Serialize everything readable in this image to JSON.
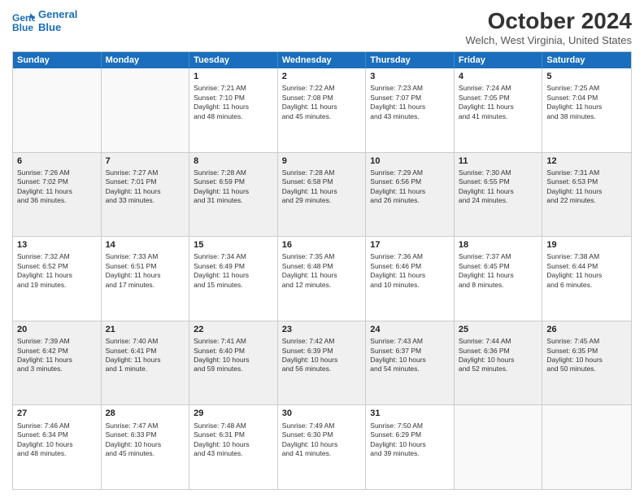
{
  "logo": {
    "line1": "General",
    "line2": "Blue"
  },
  "title": "October 2024",
  "location": "Welch, West Virginia, United States",
  "days": [
    "Sunday",
    "Monday",
    "Tuesday",
    "Wednesday",
    "Thursday",
    "Friday",
    "Saturday"
  ],
  "rows": [
    [
      {
        "day": "",
        "detail": ""
      },
      {
        "day": "",
        "detail": ""
      },
      {
        "day": "1",
        "detail": "Sunrise: 7:21 AM\nSunset: 7:10 PM\nDaylight: 11 hours\nand 48 minutes."
      },
      {
        "day": "2",
        "detail": "Sunrise: 7:22 AM\nSunset: 7:08 PM\nDaylight: 11 hours\nand 45 minutes."
      },
      {
        "day": "3",
        "detail": "Sunrise: 7:23 AM\nSunset: 7:07 PM\nDaylight: 11 hours\nand 43 minutes."
      },
      {
        "day": "4",
        "detail": "Sunrise: 7:24 AM\nSunset: 7:05 PM\nDaylight: 11 hours\nand 41 minutes."
      },
      {
        "day": "5",
        "detail": "Sunrise: 7:25 AM\nSunset: 7:04 PM\nDaylight: 11 hours\nand 38 minutes."
      }
    ],
    [
      {
        "day": "6",
        "detail": "Sunrise: 7:26 AM\nSunset: 7:02 PM\nDaylight: 11 hours\nand 36 minutes."
      },
      {
        "day": "7",
        "detail": "Sunrise: 7:27 AM\nSunset: 7:01 PM\nDaylight: 11 hours\nand 33 minutes."
      },
      {
        "day": "8",
        "detail": "Sunrise: 7:28 AM\nSunset: 6:59 PM\nDaylight: 11 hours\nand 31 minutes."
      },
      {
        "day": "9",
        "detail": "Sunrise: 7:28 AM\nSunset: 6:58 PM\nDaylight: 11 hours\nand 29 minutes."
      },
      {
        "day": "10",
        "detail": "Sunrise: 7:29 AM\nSunset: 6:56 PM\nDaylight: 11 hours\nand 26 minutes."
      },
      {
        "day": "11",
        "detail": "Sunrise: 7:30 AM\nSunset: 6:55 PM\nDaylight: 11 hours\nand 24 minutes."
      },
      {
        "day": "12",
        "detail": "Sunrise: 7:31 AM\nSunset: 6:53 PM\nDaylight: 11 hours\nand 22 minutes."
      }
    ],
    [
      {
        "day": "13",
        "detail": "Sunrise: 7:32 AM\nSunset: 6:52 PM\nDaylight: 11 hours\nand 19 minutes."
      },
      {
        "day": "14",
        "detail": "Sunrise: 7:33 AM\nSunset: 6:51 PM\nDaylight: 11 hours\nand 17 minutes."
      },
      {
        "day": "15",
        "detail": "Sunrise: 7:34 AM\nSunset: 6:49 PM\nDaylight: 11 hours\nand 15 minutes."
      },
      {
        "day": "16",
        "detail": "Sunrise: 7:35 AM\nSunset: 6:48 PM\nDaylight: 11 hours\nand 12 minutes."
      },
      {
        "day": "17",
        "detail": "Sunrise: 7:36 AM\nSunset: 6:46 PM\nDaylight: 11 hours\nand 10 minutes."
      },
      {
        "day": "18",
        "detail": "Sunrise: 7:37 AM\nSunset: 6:45 PM\nDaylight: 11 hours\nand 8 minutes."
      },
      {
        "day": "19",
        "detail": "Sunrise: 7:38 AM\nSunset: 6:44 PM\nDaylight: 11 hours\nand 6 minutes."
      }
    ],
    [
      {
        "day": "20",
        "detail": "Sunrise: 7:39 AM\nSunset: 6:42 PM\nDaylight: 11 hours\nand 3 minutes."
      },
      {
        "day": "21",
        "detail": "Sunrise: 7:40 AM\nSunset: 6:41 PM\nDaylight: 11 hours\nand 1 minute."
      },
      {
        "day": "22",
        "detail": "Sunrise: 7:41 AM\nSunset: 6:40 PM\nDaylight: 10 hours\nand 59 minutes."
      },
      {
        "day": "23",
        "detail": "Sunrise: 7:42 AM\nSunset: 6:39 PM\nDaylight: 10 hours\nand 56 minutes."
      },
      {
        "day": "24",
        "detail": "Sunrise: 7:43 AM\nSunset: 6:37 PM\nDaylight: 10 hours\nand 54 minutes."
      },
      {
        "day": "25",
        "detail": "Sunrise: 7:44 AM\nSunset: 6:36 PM\nDaylight: 10 hours\nand 52 minutes."
      },
      {
        "day": "26",
        "detail": "Sunrise: 7:45 AM\nSunset: 6:35 PM\nDaylight: 10 hours\nand 50 minutes."
      }
    ],
    [
      {
        "day": "27",
        "detail": "Sunrise: 7:46 AM\nSunset: 6:34 PM\nDaylight: 10 hours\nand 48 minutes."
      },
      {
        "day": "28",
        "detail": "Sunrise: 7:47 AM\nSunset: 6:33 PM\nDaylight: 10 hours\nand 45 minutes."
      },
      {
        "day": "29",
        "detail": "Sunrise: 7:48 AM\nSunset: 6:31 PM\nDaylight: 10 hours\nand 43 minutes."
      },
      {
        "day": "30",
        "detail": "Sunrise: 7:49 AM\nSunset: 6:30 PM\nDaylight: 10 hours\nand 41 minutes."
      },
      {
        "day": "31",
        "detail": "Sunrise: 7:50 AM\nSunset: 6:29 PM\nDaylight: 10 hours\nand 39 minutes."
      },
      {
        "day": "",
        "detail": ""
      },
      {
        "day": "",
        "detail": ""
      }
    ]
  ]
}
